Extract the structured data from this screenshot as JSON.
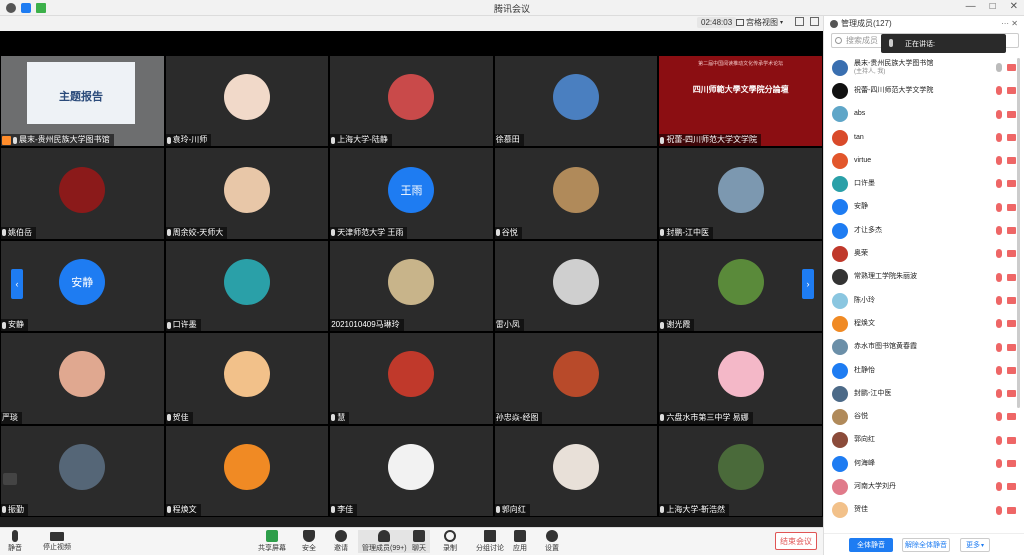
{
  "window": {
    "title": "腾讯会议"
  },
  "topbar": {
    "timer": "02:48:03",
    "view_label": "宫格视图"
  },
  "sidebar": {
    "header": "管理成员(127)",
    "search_placeholder": "搜索成员",
    "speaking_label": "正在讲话:",
    "members": [
      {
        "name": "晨末-贵州民族大学图书馆",
        "sub": "(主持人, 我)",
        "color": "#3a6fb0"
      },
      {
        "name": "祝蕾-四川师范大学文学院",
        "sub": "",
        "color": "#111"
      },
      {
        "name": "abs",
        "sub": "",
        "color": "#5fa6c8"
      },
      {
        "name": "tan",
        "sub": "",
        "color": "#d94a2a"
      },
      {
        "name": "virtue",
        "sub": "",
        "color": "#e2562b"
      },
      {
        "name": "口许墨",
        "sub": "",
        "color": "#2aa0a8"
      },
      {
        "name": "安静",
        "sub": "",
        "color": "#1e7cf2"
      },
      {
        "name": "才让多杰",
        "sub": "",
        "color": "#1e7cf2"
      },
      {
        "name": "奥荣",
        "sub": "",
        "color": "#c0392b"
      },
      {
        "name": "常熟理工学院朱丽波",
        "sub": "",
        "color": "#333"
      },
      {
        "name": "陈小玲",
        "sub": "",
        "color": "#8ac6e0"
      },
      {
        "name": "程焕文",
        "sub": "",
        "color": "#f08a24"
      },
      {
        "name": "赤水市图书馆黄春霞",
        "sub": "",
        "color": "#6b8fa8"
      },
      {
        "name": "杜静怡",
        "sub": "",
        "color": "#1e7cf2"
      },
      {
        "name": "封鹏-江中医",
        "sub": "",
        "color": "#4c6a88"
      },
      {
        "name": "谷悦",
        "sub": "",
        "color": "#b08a5a"
      },
      {
        "name": "郭向红",
        "sub": "",
        "color": "#8b4b3a"
      },
      {
        "name": "何海峰",
        "sub": "",
        "color": "#1e7cf2"
      },
      {
        "name": "河南大学刘丹",
        "sub": "",
        "color": "#e07a8a"
      },
      {
        "name": "贺佳",
        "sub": "",
        "color": "#f2c18a"
      }
    ],
    "btn_mute_all": "全体静音",
    "btn_unmute_all": "解除全体静音",
    "btn_more": "更多"
  },
  "tiles": [
    {
      "name": "晨末-贵州民族大学图书馆",
      "type": "slide",
      "slide_title": "主题报告",
      "speaking": true
    },
    {
      "name": "袁玲-川师",
      "type": "avatar",
      "color": "#f1d9c9"
    },
    {
      "name": "上海大学-陆静",
      "type": "avatar",
      "color": "#c94a4a"
    },
    {
      "name": "徐慕田",
      "type": "avatar",
      "color": "#4a7fc0",
      "nomic": true
    },
    {
      "name": "祝蕾-四川师范大学文学院",
      "type": "red",
      "red_title": "四川师範大學文學院分論壇",
      "red_sub": "第二届中国阅读推动文化传承学术论坛"
    },
    {
      "name": "姚伯岳",
      "type": "avatar",
      "color": "#8b1a1a"
    },
    {
      "name": "周余姣-天师大",
      "type": "avatar",
      "color": "#e8c7a8"
    },
    {
      "name": "天津师范大学 王雨",
      "type": "blue",
      "label": "王雨"
    },
    {
      "name": "谷悦",
      "type": "avatar",
      "color": "#b08a5a"
    },
    {
      "name": "封鹏-江中医",
      "type": "avatar",
      "color": "#7c98b0"
    },
    {
      "name": "安静",
      "type": "blue",
      "label": "安静"
    },
    {
      "name": "口许墨",
      "type": "avatar",
      "color": "#2aa0a8"
    },
    {
      "name": "2021010409马琳玲",
      "type": "avatar",
      "color": "#c8b48a",
      "nomic": true
    },
    {
      "name": "雷小凤",
      "type": "avatar",
      "color": "#cfcfcf",
      "nomic": true
    },
    {
      "name": "谢光霞",
      "type": "avatar",
      "color": "#5a8a3a"
    },
    {
      "name": "严琰",
      "type": "avatar",
      "color": "#e0a890",
      "nomic": true
    },
    {
      "name": "贺佳",
      "type": "avatar",
      "color": "#f2c18a"
    },
    {
      "name": "慧",
      "type": "avatar",
      "color": "#c0392b"
    },
    {
      "name": "孙忠焱-经图",
      "type": "avatar",
      "color": "#b84a2a",
      "nomic": true
    },
    {
      "name": "六盘水市第三中学 易娜",
      "type": "avatar",
      "color": "#f4b8c8"
    },
    {
      "name": "振勤",
      "type": "avatar",
      "color": "#556677"
    },
    {
      "name": "程焕文",
      "type": "avatar",
      "color": "#f08a24"
    },
    {
      "name": "李佳",
      "type": "avatar",
      "color": "#f2f2f2"
    },
    {
      "name": "郭向红",
      "type": "avatar",
      "color": "#e8e0d8"
    },
    {
      "name": "上海大学-靳浩然",
      "type": "avatar",
      "color": "#4a6a3a"
    }
  ],
  "bottombar": {
    "mute": "静音",
    "stop_video": "停止视频",
    "share": "共享屏幕",
    "security": "安全",
    "invite": "邀请",
    "manage": "管理成员(99+)",
    "chat": "聊天",
    "record": "录制",
    "breakout": "分组讨论",
    "apps": "应用",
    "settings": "设置",
    "end": "结束会议"
  },
  "colors": {
    "accent": "#1e7cf2",
    "end": "#e05555"
  }
}
